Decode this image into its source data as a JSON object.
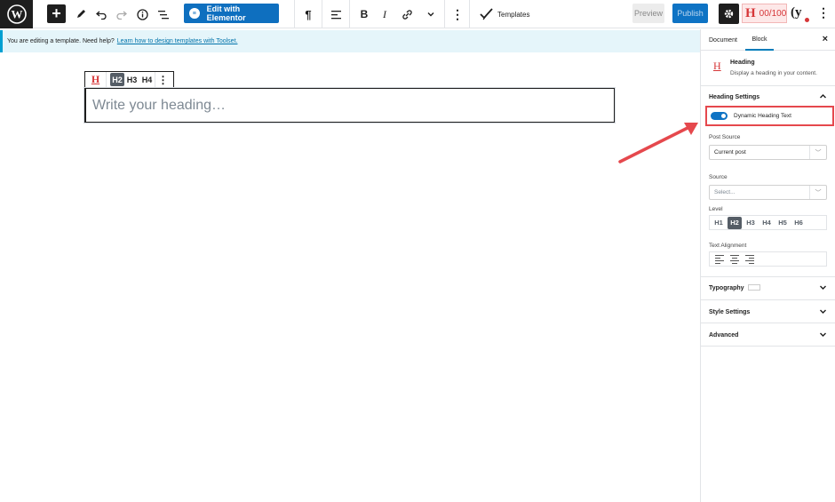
{
  "toolbar": {
    "wp_logo": "W",
    "inserter_label": "+",
    "elementor_label": "Edit with Elementor",
    "templates_label": "Templates",
    "preview_label": "Preview",
    "publish_label": "Publish",
    "score_label": "00/100",
    "icons": [
      "wordpress-logo",
      "plus-icon",
      "pencil-icon",
      "undo-icon",
      "redo-icon",
      "info-icon",
      "list-view-icon",
      "paragraph-icon",
      "align-icon",
      "bold-icon",
      "italic-icon",
      "link-icon",
      "chevron-down-icon",
      "more-vertical-icon",
      "templates-icon",
      "gear-icon",
      "yoast-icon"
    ]
  },
  "notice": {
    "text": "You are editing a template. Need help?",
    "link": "Learn how to design templates with Toolset."
  },
  "block_toolbar": {
    "levels": [
      "H2",
      "H3",
      "H4"
    ]
  },
  "editor": {
    "heading_placeholder": "Write your heading…"
  },
  "sidebar": {
    "tabs": [
      "Document",
      "Block"
    ],
    "active_tab": "Block",
    "block_title": "Heading",
    "block_desc": "Display a heading in your content.",
    "heading_settings_title": "Heading Settings",
    "dynamic_toggle_label": "Dynamic Heading Text",
    "dynamic_toggle_on": true,
    "post_source_label": "Post Source",
    "post_source_value": "Current post",
    "source_label": "Source",
    "source_placeholder": "Select...",
    "level_label": "Level",
    "levels": [
      "H1",
      "H2",
      "H3",
      "H4",
      "H5",
      "H6"
    ],
    "active_level": "H2",
    "text_alignment_label": "Text Alignment",
    "typography_title": "Typography",
    "style_settings_title": "Style Settings",
    "advanced_title": "Advanced"
  },
  "colors": {
    "accent": "#0e73c4",
    "highlight": "#e5484d",
    "notice_bg": "#e5f5fa"
  }
}
